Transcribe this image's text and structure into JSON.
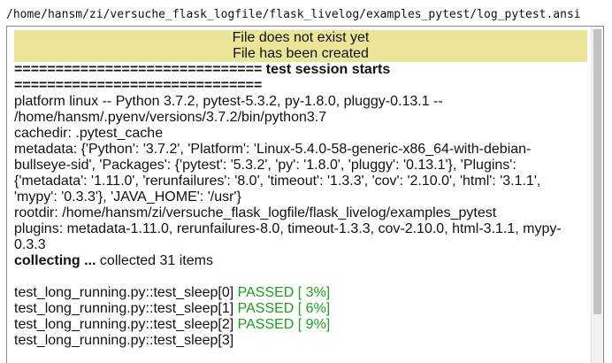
{
  "file_path": "/home/hansm/zi/versuche_flask_logfile/flask_livelog/examples_pytest/log_pytest.ansi",
  "banner": {
    "line1": "File does not exist yet",
    "line2": "File has been created",
    "background": "#ebe59a"
  },
  "log": {
    "session_header": "============================== test session starts ==============================",
    "platform": "platform linux -- Python 3.7.2, pytest-5.3.2, py-1.8.0, pluggy-0.13.1 -- /home/hansm/.pyenv/versions/3.7.2/bin/python3.7",
    "cachedir": "cachedir: .pytest_cache",
    "metadata": "metadata: {'Python': '3.7.2', 'Platform': 'Linux-5.4.0-58-generic-x86_64-with-debian-bullseye-sid', 'Packages': {'pytest': '5.3.2', 'py': '1.8.0', 'pluggy': '0.13.1'}, 'Plugins': {'metadata': '1.11.0', 'rerunfailures': '8.0', 'timeout': '1.3.3', 'cov': '2.10.0', 'html': '3.1.1', 'mypy': '0.3.3'}, 'JAVA_HOME': '/usr'}",
    "rootdir": "rootdir: /home/hansm/zi/versuche_flask_logfile/flask_livelog/examples_pytest",
    "plugins": "plugins: metadata-1.11.0, rerunfailures-8.0, timeout-1.3.3, cov-2.10.0, html-3.1.1, mypy-0.3.3",
    "collecting_bold": "collecting ...",
    "collecting_rest": " collected 31 items",
    "tests": [
      {
        "name": "test_long_running.py::test_sleep[0]",
        "status": " PASSED [ 3%]"
      },
      {
        "name": "test_long_running.py::test_sleep[1]",
        "status": " PASSED [ 6%]"
      },
      {
        "name": "test_long_running.py::test_sleep[2]",
        "status": " PASSED [ 9%]"
      },
      {
        "name": "test_long_running.py::test_sleep[3]",
        "status": ""
      }
    ],
    "passed_color": "#1aa01a"
  }
}
